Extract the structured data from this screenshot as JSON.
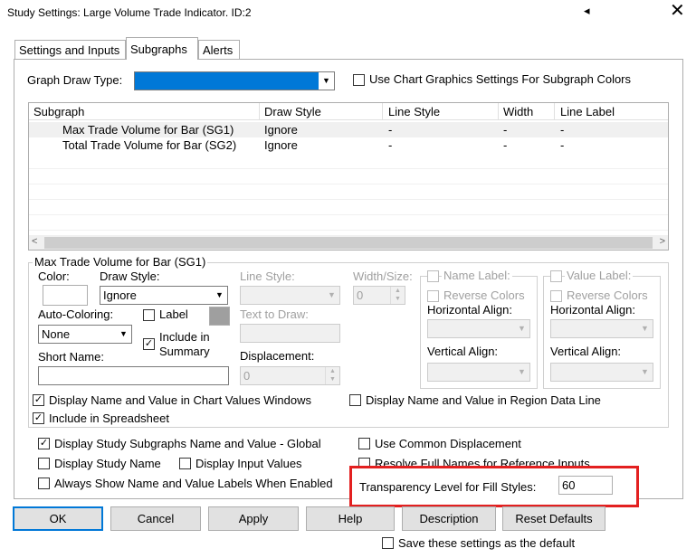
{
  "window": {
    "title": "Study Settings: Large Volume Trade Indicator. ID:2",
    "help_glyph": "◂",
    "close_glyph": "✕"
  },
  "tabs": [
    {
      "label": "Settings and Inputs"
    },
    {
      "label": "Subgraphs"
    },
    {
      "label": "Alerts"
    }
  ],
  "graph_draw_type": {
    "label": "Graph Draw Type:",
    "value": "",
    "selected_color": "#0078d7"
  },
  "use_chart_graphics": {
    "label": "Use Chart Graphics Settings For Subgraph Colors",
    "checked": false
  },
  "subgraph_list": {
    "columns": [
      "Subgraph",
      "Draw Style",
      "Line Style",
      "Width",
      "Line Label"
    ],
    "rows": [
      [
        "Max Trade Volume for Bar (SG1)",
        "Ignore",
        "-",
        "-",
        "-"
      ],
      [
        "Total Trade Volume for Bar (SG2)",
        "Ignore",
        "-",
        "-",
        "-"
      ]
    ]
  },
  "subgraph_group": {
    "title": "Max Trade Volume for Bar (SG1)",
    "color_label": "Color:",
    "color_value": "#ffffff",
    "draw_style_label": "Draw Style:",
    "draw_style_value": "Ignore",
    "line_style_label": "Line Style:",
    "width_size_label": "Width/Size:",
    "width_size_value": "0",
    "auto_coloring_label": "Auto-Coloring:",
    "auto_coloring_value": "None",
    "label_check": "Label",
    "include_summary_check": "Include in Summary",
    "text_to_draw_label": "Text to Draw:",
    "short_name_label": "Short Name:",
    "displacement_label": "Displacement:",
    "displacement_value": "0",
    "name_label": "Name Label:",
    "value_label": "Value Label:",
    "reverse_colors": "Reverse Colors",
    "horizontal_align": "Horizontal Align:",
    "vertical_align": "Vertical Align:",
    "display_name_chart": "Display Name and Value in Chart Values Windows",
    "display_name_region": "Display Name and Value in Region Data Line",
    "include_spreadsheet": "Include in Spreadsheet"
  },
  "global_options": {
    "display_subgraphs_global": "Display Study Subgraphs Name and Value - Global",
    "use_common_displacement": "Use Common Displacement",
    "display_study_name": "Display Study Name",
    "display_input_values": "Display Input Values",
    "resolve_full_names": "Resolve Full Names for Reference Inputs",
    "always_show_labels": "Always Show Name and Value Labels When Enabled",
    "transparency_label": "Transparency Level for Fill Styles:",
    "transparency_value": "60"
  },
  "buttons": {
    "ok": "OK",
    "cancel": "Cancel",
    "apply": "Apply",
    "help": "Help",
    "description": "Description",
    "reset_defaults": "Reset Defaults"
  },
  "save_default": {
    "label": "Save these settings as the default",
    "checked": false
  },
  "glyphs": {
    "check": "✓",
    "arrow_down": "▼",
    "arrow_left": "<",
    "arrow_right": ">",
    "spin_up": "▲",
    "spin_down": "▼"
  },
  "colors": {
    "highlight": "#e32020",
    "accent": "#0078d7"
  }
}
